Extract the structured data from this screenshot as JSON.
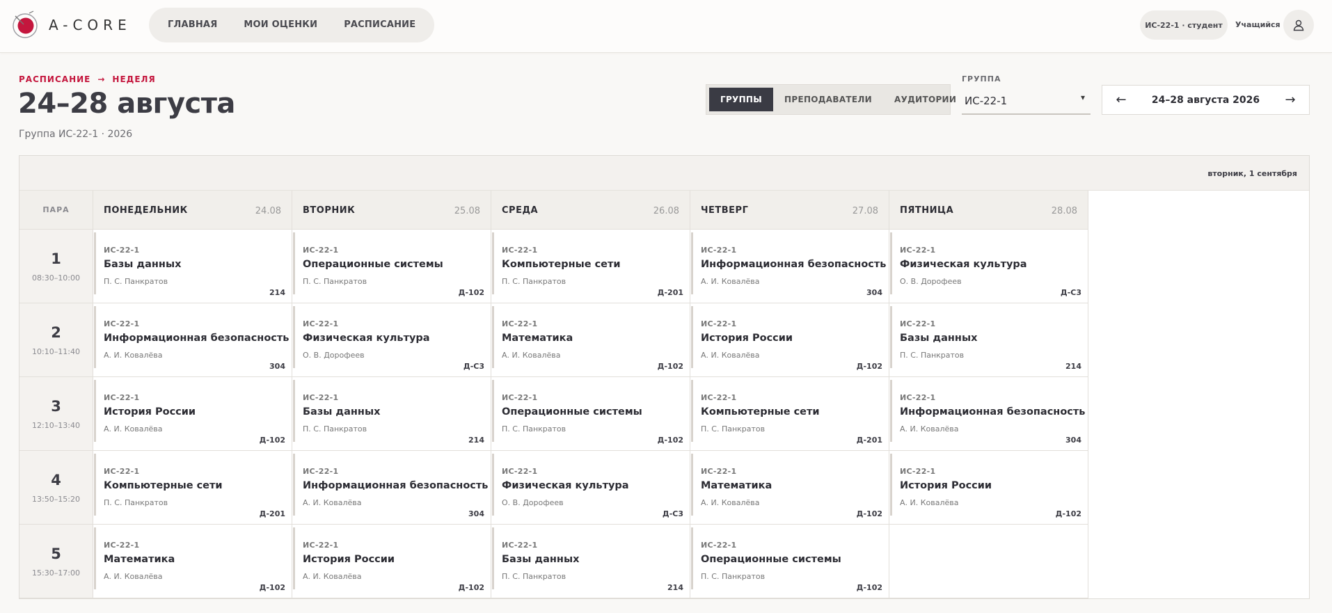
{
  "brand": {
    "name": "A-CORE",
    "accent": "#c4163d"
  },
  "nav": [
    "ГЛАВНАЯ",
    "МОИ ОЦЕНКИ",
    "РАСПИСАНИЕ"
  ],
  "user": {
    "role": "ИС-22-1 · студент",
    "label": "Учащийся",
    "icon": "user-icon"
  },
  "breadcrumb": {
    "root": "РАСПИСАНИЕ",
    "arrow": "→",
    "current": "НЕДЕЛЯ"
  },
  "title": "24–28 августа",
  "subtitle": "Группа ИС-22-1 · 2026",
  "view_tabs": [
    "ГРУППЫ",
    "ПРЕПОДАВАТЕЛИ",
    "АУДИТОРИИ"
  ],
  "active_tab": "ГРУППЫ",
  "group_select": {
    "label": "ГРУППА",
    "value": "ИС-22-1"
  },
  "week": {
    "prev": "←",
    "label": "24–28 августа 2026",
    "next": "→"
  },
  "today_label": "вторник, 1 сентября",
  "para_header": "ПАРА",
  "days": [
    {
      "name": "ПОНЕДЕЛЬНИК",
      "date": "24.08"
    },
    {
      "name": "ВТОРНИК",
      "date": "25.08"
    },
    {
      "name": "СРЕДА",
      "date": "26.08"
    },
    {
      "name": "ЧЕТВЕРГ",
      "date": "27.08"
    },
    {
      "name": "ПЯТНИЦА",
      "date": "28.08"
    }
  ],
  "periods": [
    {
      "num": "1",
      "time": "08:30–10:00"
    },
    {
      "num": "2",
      "time": "10:10–11:40"
    },
    {
      "num": "3",
      "time": "12:10–13:40"
    },
    {
      "num": "4",
      "time": "13:50–15:20"
    },
    {
      "num": "5",
      "time": "15:30–17:00"
    }
  ],
  "lessons": [
    [
      {
        "group": "ИС-22-1",
        "subject": "Базы данных",
        "teacher": "П. С. Панкратов",
        "room": "214"
      },
      {
        "group": "ИС-22-1",
        "subject": "Операционные системы",
        "teacher": "П. С. Панкратов",
        "room": "Д-102"
      },
      {
        "group": "ИС-22-1",
        "subject": "Компьютерные сети",
        "teacher": "П. С. Панкратов",
        "room": "Д-201"
      },
      {
        "group": "ИС-22-1",
        "subject": "Информационная безопасность",
        "teacher": "А. И. Ковалёва",
        "room": "304"
      },
      {
        "group": "ИС-22-1",
        "subject": "Физическая культура",
        "teacher": "О. В. Дорофеев",
        "room": "Д-С3"
      }
    ],
    [
      {
        "group": "ИС-22-1",
        "subject": "Информационная безопасность",
        "teacher": "А. И. Ковалёва",
        "room": "304"
      },
      {
        "group": "ИС-22-1",
        "subject": "Физическая культура",
        "teacher": "О. В. Дорофеев",
        "room": "Д-С3"
      },
      {
        "group": "ИС-22-1",
        "subject": "Математика",
        "teacher": "А. И. Ковалёва",
        "room": "Д-102"
      },
      {
        "group": "ИС-22-1",
        "subject": "История России",
        "teacher": "А. И. Ковалёва",
        "room": "Д-102"
      },
      {
        "group": "ИС-22-1",
        "subject": "Базы данных",
        "teacher": "П. С. Панкратов",
        "room": "214"
      }
    ],
    [
      {
        "group": "ИС-22-1",
        "subject": "История России",
        "teacher": "А. И. Ковалёва",
        "room": "Д-102"
      },
      {
        "group": "ИС-22-1",
        "subject": "Базы данных",
        "teacher": "П. С. Панкратов",
        "room": "214"
      },
      {
        "group": "ИС-22-1",
        "subject": "Операционные системы",
        "teacher": "П. С. Панкратов",
        "room": "Д-102"
      },
      {
        "group": "ИС-22-1",
        "subject": "Компьютерные сети",
        "teacher": "П. С. Панкратов",
        "room": "Д-201"
      },
      {
        "group": "ИС-22-1",
        "subject": "Информационная безопасность",
        "teacher": "А. И. Ковалёва",
        "room": "304"
      }
    ],
    [
      {
        "group": "ИС-22-1",
        "subject": "Компьютерные сети",
        "teacher": "П. С. Панкратов",
        "room": "Д-201"
      },
      {
        "group": "ИС-22-1",
        "subject": "Информационная безопасность",
        "teacher": "А. И. Ковалёва",
        "room": "304"
      },
      {
        "group": "ИС-22-1",
        "subject": "Физическая культура",
        "teacher": "О. В. Дорофеев",
        "room": "Д-С3"
      },
      {
        "group": "ИС-22-1",
        "subject": "Математика",
        "teacher": "А. И. Ковалёва",
        "room": "Д-102"
      },
      {
        "group": "ИС-22-1",
        "subject": "История России",
        "teacher": "А. И. Ковалёва",
        "room": "Д-102"
      }
    ],
    [
      {
        "group": "ИС-22-1",
        "subject": "Математика",
        "teacher": "А. И. Ковалёва",
        "room": "Д-102"
      },
      {
        "group": "ИС-22-1",
        "subject": "История России",
        "teacher": "А. И. Ковалёва",
        "room": "Д-102"
      },
      {
        "group": "ИС-22-1",
        "subject": "Базы данных",
        "teacher": "П. С. Панкратов",
        "room": "214"
      },
      {
        "group": "ИС-22-1",
        "subject": "Операционные системы",
        "teacher": "П. С. Панкратов",
        "room": "Д-102"
      },
      null
    ]
  ]
}
